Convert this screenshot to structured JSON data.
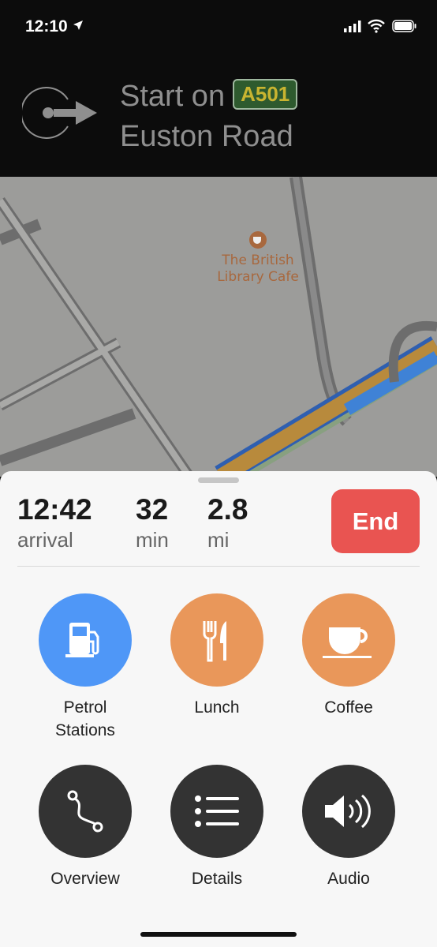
{
  "status": {
    "time": "12:10"
  },
  "banner": {
    "instruction": "Start on",
    "road_number": "A501",
    "road_name": "Euston Road"
  },
  "map": {
    "poi": "The British Library Cafe",
    "poi_line1": "The British",
    "poi_line2": "Library Cafe"
  },
  "trip": {
    "arrival": "12:42",
    "arrival_label": "arrival",
    "duration": "32",
    "duration_label": "min",
    "distance": "2.8",
    "distance_label": "mi",
    "end_label": "End"
  },
  "actions": [
    {
      "label": "Petrol Stations",
      "line1": "Petrol",
      "line2": "Stations",
      "icon": "fuel-pump-icon",
      "color": "#4f97f7"
    },
    {
      "label": "Lunch",
      "icon": "fork-knife-icon",
      "color": "#e9975a"
    },
    {
      "label": "Coffee",
      "icon": "coffee-cup-icon",
      "color": "#e9975a"
    },
    {
      "label": "Overview",
      "icon": "route-icon",
      "color": "#333333"
    },
    {
      "label": "Details",
      "icon": "list-icon",
      "color": "#333333"
    },
    {
      "label": "Audio",
      "icon": "speaker-icon",
      "color": "#333333"
    }
  ]
}
